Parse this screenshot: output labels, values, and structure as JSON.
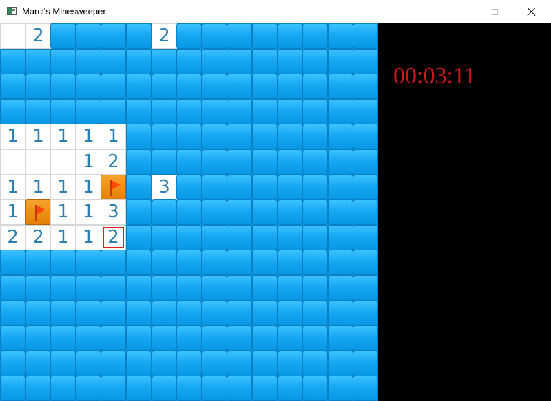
{
  "window": {
    "title": "Marci's Minesweeper"
  },
  "timer": {
    "text": "00:03:11",
    "color": "#d11818"
  },
  "board": {
    "rows": 15,
    "cols": 15,
    "selected": [
      8,
      4
    ],
    "cells": [
      [
        "E",
        "2",
        "H",
        "H",
        "H",
        "H",
        "2",
        "H",
        "H",
        "H",
        "H",
        "H",
        "H",
        "H",
        "H"
      ],
      [
        "H",
        "H",
        "H",
        "H",
        "H",
        "H",
        "H",
        "H",
        "H",
        "H",
        "H",
        "H",
        "H",
        "H",
        "H"
      ],
      [
        "H",
        "H",
        "H",
        "H",
        "H",
        "H",
        "H",
        "H",
        "H",
        "H",
        "H",
        "H",
        "H",
        "H",
        "H"
      ],
      [
        "H",
        "H",
        "H",
        "H",
        "H",
        "H",
        "H",
        "H",
        "H",
        "H",
        "H",
        "H",
        "H",
        "H",
        "H"
      ],
      [
        "1",
        "1",
        "1",
        "1",
        "1",
        "H",
        "H",
        "H",
        "H",
        "H",
        "H",
        "H",
        "H",
        "H",
        "H"
      ],
      [
        "E",
        "E",
        "E",
        "1",
        "2",
        "H",
        "H",
        "H",
        "H",
        "H",
        "H",
        "H",
        "H",
        "H",
        "H"
      ],
      [
        "1",
        "1",
        "1",
        "1",
        "F",
        "H",
        "3",
        "H",
        "H",
        "H",
        "H",
        "H",
        "H",
        "H",
        "H"
      ],
      [
        "1",
        "F",
        "1",
        "1",
        "3",
        "H",
        "H",
        "H",
        "H",
        "H",
        "H",
        "H",
        "H",
        "H",
        "H"
      ],
      [
        "2",
        "2",
        "1",
        "1",
        "2",
        "H",
        "H",
        "H",
        "H",
        "H",
        "H",
        "H",
        "H",
        "H",
        "H"
      ],
      [
        "H",
        "H",
        "H",
        "H",
        "H",
        "H",
        "H",
        "H",
        "H",
        "H",
        "H",
        "H",
        "H",
        "H",
        "H"
      ],
      [
        "H",
        "H",
        "H",
        "H",
        "H",
        "H",
        "H",
        "H",
        "H",
        "H",
        "H",
        "H",
        "H",
        "H",
        "H"
      ],
      [
        "H",
        "H",
        "H",
        "H",
        "H",
        "H",
        "H",
        "H",
        "H",
        "H",
        "H",
        "H",
        "H",
        "H",
        "H"
      ],
      [
        "H",
        "H",
        "H",
        "H",
        "H",
        "H",
        "H",
        "H",
        "H",
        "H",
        "H",
        "H",
        "H",
        "H",
        "H"
      ],
      [
        "H",
        "H",
        "H",
        "H",
        "H",
        "H",
        "H",
        "H",
        "H",
        "H",
        "H",
        "H",
        "H",
        "H",
        "H"
      ],
      [
        "H",
        "H",
        "H",
        "H",
        "H",
        "H",
        "H",
        "H",
        "H",
        "H",
        "H",
        "H",
        "H",
        "H",
        "H"
      ]
    ],
    "legend": {
      "H": "hidden",
      "E": "revealed-empty",
      "F": "flag"
    }
  },
  "icons": {
    "app": "app-window-icon",
    "flag": "flag-icon"
  },
  "colors": {
    "hidden_tile": "#16a8f3",
    "number": "#2c7fb1",
    "flag_tile": "#e37f06",
    "flag": "#ff4a0a",
    "panel": "#000000",
    "selected_outline": "#e02020"
  }
}
